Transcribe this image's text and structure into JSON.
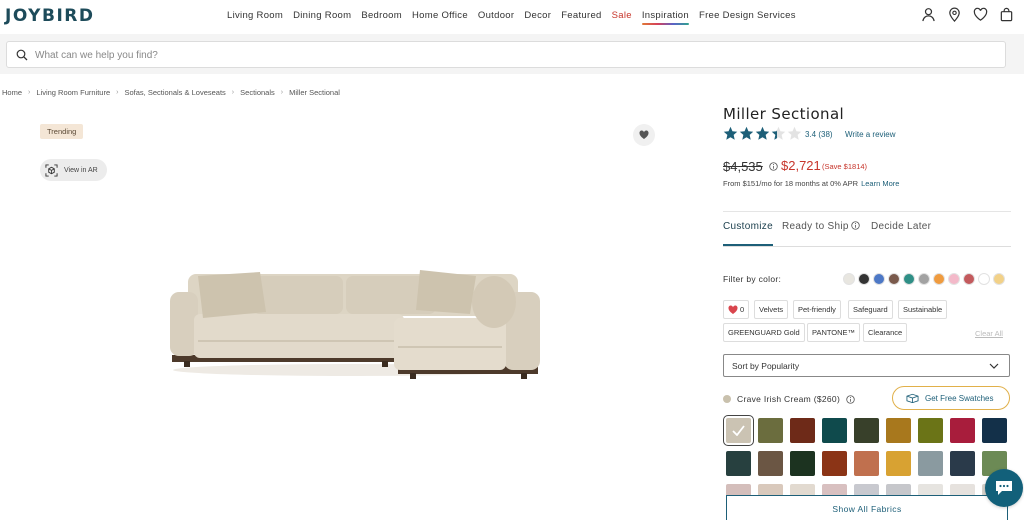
{
  "brand": {
    "logo": "JOYBIRD"
  },
  "nav": {
    "items": [
      "Living Room",
      "Dining Room",
      "Bedroom",
      "Home Office",
      "Outdoor",
      "Decor",
      "Featured",
      "Sale",
      "Inspiration",
      "Free Design Services"
    ]
  },
  "header_icons": [
    "account-icon",
    "location-icon",
    "wishlist-heart-icon",
    "cart-bag-icon"
  ],
  "search": {
    "placeholder": "What can we help you find?"
  },
  "breadcrumb": [
    "Home",
    "Living Room Furniture",
    "Sofas, Sectionals & Loveseats",
    "Sectionals",
    "Miller Sectional"
  ],
  "gallery": {
    "badge": "Trending",
    "view_ar": "View in AR"
  },
  "product": {
    "title": "Miller Sectional",
    "rating": "3.4",
    "rating_stars": 3.4,
    "review_count": "(38)",
    "write_review": "Write a review",
    "original_price": "$4,535",
    "sale_price": "$2,721",
    "savings": "(Save $1814)",
    "finance_text": "From $151/mo for 18 months at 0% APR",
    "learn_more": "Learn More"
  },
  "tabs": [
    "Customize",
    "Ready to Ship",
    "Decide Later"
  ],
  "filter": {
    "label": "Filter by color:",
    "colors": [
      "#e8e6e0",
      "#333333",
      "#4d78c6",
      "#7a5a4c",
      "#2f8f86",
      "#a2a2a2",
      "#ef9b3f",
      "#f3b9c9",
      "#c35a5d",
      "#ffffff",
      "#f2d188"
    ],
    "chips": [
      "0",
      "Velvets",
      "Pet-friendly",
      "Safeguard",
      "Sustainable",
      "GREENGUARD Gold",
      "PANTONE™",
      "Clearance"
    ],
    "clear_all": "Clear All"
  },
  "sort": {
    "value": "Sort by Popularity"
  },
  "fabric": {
    "selected_name": "Crave Irish Cream ($260)",
    "swatch_button": "Get Free Swatches",
    "row1": [
      "#cbc3b3",
      "#6b6d3e",
      "#6e2a18",
      "#0f4a4c",
      "#38402a",
      "#a8781d",
      "#6b7417",
      "#a81d3c",
      "#133049"
    ],
    "row2": [
      "#27403f",
      "#6b5644",
      "#1c3320",
      "#8b3416",
      "#c0704e",
      "#d8a232",
      "#8a9aa0",
      "#2a3a4a",
      "#6c8a55"
    ],
    "row3": [
      "#d4bebb",
      "#d9c9bc",
      "#e2dad0",
      "#d8c0c0",
      "#c8c9cf",
      "#c6c7cb",
      "#e6e4e0",
      "#e6e2de",
      "#d7d3cc"
    ],
    "show_all": "Show All Fabrics"
  }
}
